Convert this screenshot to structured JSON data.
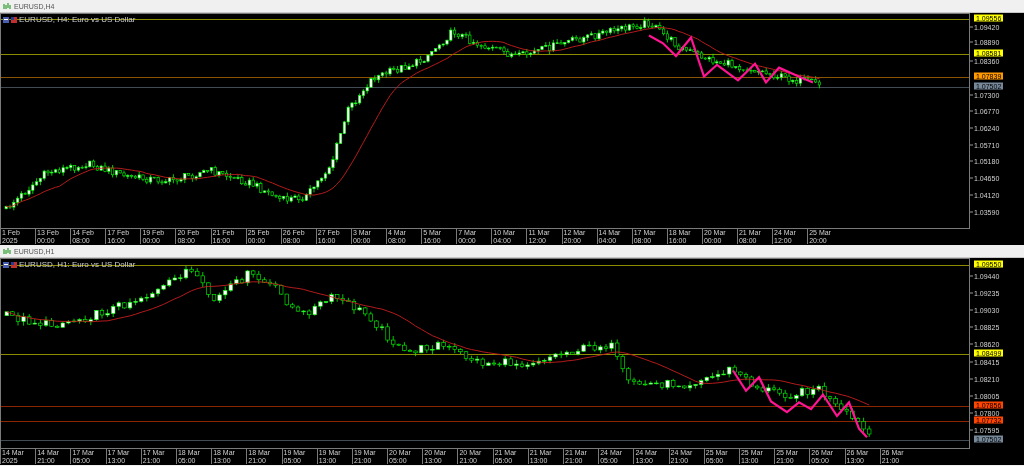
{
  "panels": [
    {
      "title": "EURUSD,H4",
      "header": "EURUSD, H4:  Euro vs US Dollar",
      "price_ticks": [
        "1.09420",
        "1.08890",
        "1.08360",
        "1.07300",
        "1.06770",
        "1.06240",
        "1.05710",
        "1.05180",
        "1.04650",
        "1.04120",
        "1.03590"
      ],
      "price_levels": [
        {
          "price": "1.09556",
          "color": "#ffff00"
        },
        {
          "price": "1.08581",
          "color": "#ffff00"
        },
        {
          "price": "1.07839",
          "color": "#ff9900"
        },
        {
          "price": "1.07502",
          "color": "#778899"
        }
      ],
      "time_ticks": [
        "1 Feb 2025",
        "13 Feb 00:00",
        "14 Feb 08:00",
        "17 Feb 16:00",
        "19 Feb 00:00",
        "20 Feb 08:00",
        "21 Feb 16:00",
        "25 Feb 00:00",
        "26 Feb 08:00",
        "27 Feb 16:00",
        "3 Mar 00:00",
        "4 Mar 08:00",
        "5 Mar 16:00",
        "7 Mar 00:00",
        "10 Mar 04:00",
        "11 Mar 12:00",
        "12 Mar 20:00",
        "14 Mar 04:00",
        "17 Mar 08:00",
        "18 Mar 16:00",
        "20 Mar 00:00",
        "21 Mar 08:00",
        "24 Mar 12:00",
        "25 Mar 20:00"
      ]
    },
    {
      "title": "EURUSD,H1",
      "header": "EURUSD, H1:  Euro vs US Dollar",
      "price_ticks": [
        "1.09440",
        "1.09235",
        "1.09030",
        "1.08825",
        "1.08620",
        "1.08415",
        "1.08210",
        "1.08005",
        "1.07800",
        "1.07595"
      ],
      "price_levels": [
        {
          "price": "1.09550",
          "color": "#ffff00"
        },
        {
          "price": "1.08499",
          "color": "#ffff00"
        },
        {
          "price": "1.07856",
          "color": "#ff4500"
        },
        {
          "price": "1.07732",
          "color": "#ff4500"
        },
        {
          "price": "1.07502",
          "color": "#778899"
        }
      ],
      "time_ticks": [
        "14 Mar 2025",
        "14 Mar 21:00",
        "17 Mar 05:00",
        "17 Mar 13:00",
        "17 Mar 21:00",
        "18 Mar 05:00",
        "18 Mar 13:00",
        "18 Mar 21:00",
        "19 Mar 05:00",
        "19 Mar 13:00",
        "19 Mar 21:00",
        "20 Mar 05:00",
        "20 Mar 13:00",
        "20 Mar 21:00",
        "21 Mar 05:00",
        "21 Mar 13:00",
        "21 Mar 21:00",
        "24 Mar 05:00",
        "24 Mar 13:00",
        "24 Mar 21:00",
        "25 Mar 05:00",
        "25 Mar 13:00",
        "25 Mar 21:00",
        "26 Mar 05:00",
        "26 Mar 13:00",
        "26 Mar 21:00"
      ]
    }
  ]
}
